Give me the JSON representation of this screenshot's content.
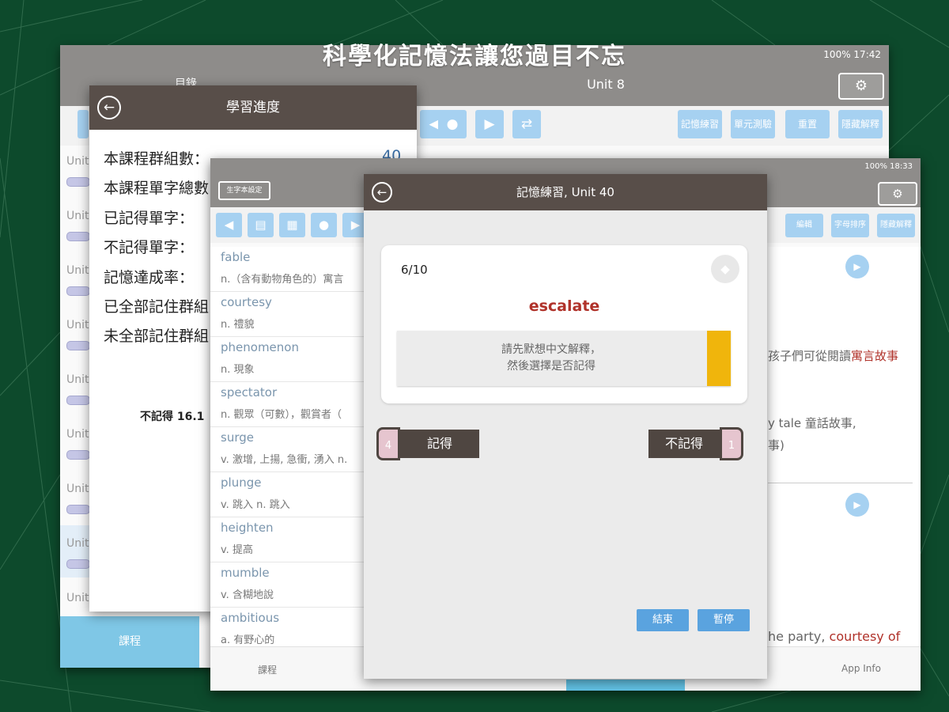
{
  "headline": "科學化記憶法讓您過目不忘",
  "back_tablet": {
    "status": "100% 17:42",
    "nav_title": "Unit 8",
    "nav_left": "目錄",
    "toolbar_buttons": [
      "記憶練習",
      "單元測驗",
      "重置",
      "隱藏解釋"
    ],
    "toolbar_icons": [
      "speaker-icon",
      "mic-icon",
      "play-icon",
      "swap-icon"
    ],
    "units": [
      "Unit",
      "Unit",
      "Unit",
      "Unit",
      "Unit",
      "Unit",
      "Unit",
      "Unit",
      "Unit"
    ],
    "bottom_tab_active": "課程"
  },
  "progress_dialog": {
    "title": "學習進度",
    "rows": [
      {
        "label": "本課程群組數：",
        "value": "40"
      },
      {
        "label": "本課程單字總數",
        "value": ""
      },
      {
        "label": "已記得單字：",
        "value": ""
      },
      {
        "label": "不記得單字：",
        "value": ""
      },
      {
        "label": "記憶達成率：",
        "value": ""
      },
      {
        "label": "已全部記住群組",
        "value": ""
      },
      {
        "label": "未全部記住群組",
        "value": ""
      }
    ],
    "footer_stat": "不記得 16.1"
  },
  "front_tablet": {
    "status": "100% 18:33",
    "left_button": "生字本設定",
    "toolbar_buttons": [
      "編輯",
      "字母排序",
      "隱藏解釋"
    ],
    "words": [
      {
        "en": "fable",
        "zh": "n.（含有動物角色的）寓言"
      },
      {
        "en": "courtesy",
        "zh": "n. 禮貌"
      },
      {
        "en": "phenomenon",
        "zh": "n. 現象"
      },
      {
        "en": "spectator",
        "zh": "n. 觀眾（可數），觀賞者（"
      },
      {
        "en": "surge",
        "zh": "v. 激增, 上揚, 急衝, 湧入  n."
      },
      {
        "en": "plunge",
        "zh": "v. 跳入  n. 跳入"
      },
      {
        "en": "heighten",
        "zh": "v. 提高"
      },
      {
        "en": "mumble",
        "zh": "v. 含糊地說"
      },
      {
        "en": "ambitious",
        "zh": "a. 有野心的"
      }
    ],
    "detail_lines": {
      "line1_plain": "孩子們可從閱讀",
      "line1_red": "寓言故事",
      "line2": "y tale 童話故事,",
      "line3": "事)",
      "line4_plain": "he party, ",
      "line4_red": "courtesy of"
    },
    "bottom_tabs": [
      "課程",
      "App Info"
    ]
  },
  "memory_dialog": {
    "title": "記憶練習, Unit 40",
    "counter": "6/10",
    "word": "escalate",
    "hint_line1": "請先默想中文解釋，",
    "hint_line2": "然後選擇是否記得",
    "remember_label": "記得",
    "remember_count": "4",
    "forget_label": "不記得",
    "forget_count": "1",
    "end_button": "結束",
    "pause_button": "暫停"
  },
  "colors": {
    "background": "#0d4a2c",
    "dialog_header": "#584e49",
    "button_blue": "#a6d1f1",
    "word_red": "#b0322a",
    "hint_yellow": "#f0b50c",
    "link_red": "#b0322a"
  }
}
